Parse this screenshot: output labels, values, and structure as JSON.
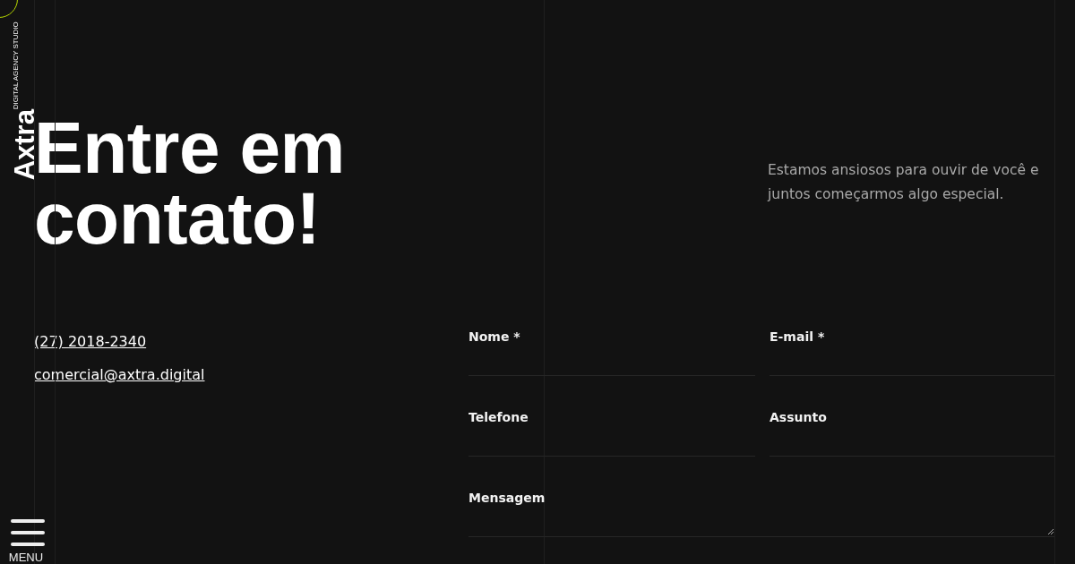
{
  "logo": {
    "wordmark": "Axtra",
    "tagline": "DIGITAL AGENCY STUDIO"
  },
  "menu": {
    "label": "MENU"
  },
  "heading": "Entre em contato!",
  "intro": "Estamos ansiosos para ouvir de você e juntos começarmos algo especial.",
  "contacts": [
    {
      "text": "(27) 2018-2340"
    },
    {
      "text": "comercial@axtra.digital"
    }
  ],
  "form": {
    "fields": [
      {
        "label": "Nome *",
        "kind": "input"
      },
      {
        "label": "E-mail *",
        "kind": "input"
      },
      {
        "label": "Telefone",
        "kind": "input"
      },
      {
        "label": "Assunto",
        "kind": "input"
      },
      {
        "label": "Mensagem",
        "kind": "textarea"
      }
    ]
  }
}
